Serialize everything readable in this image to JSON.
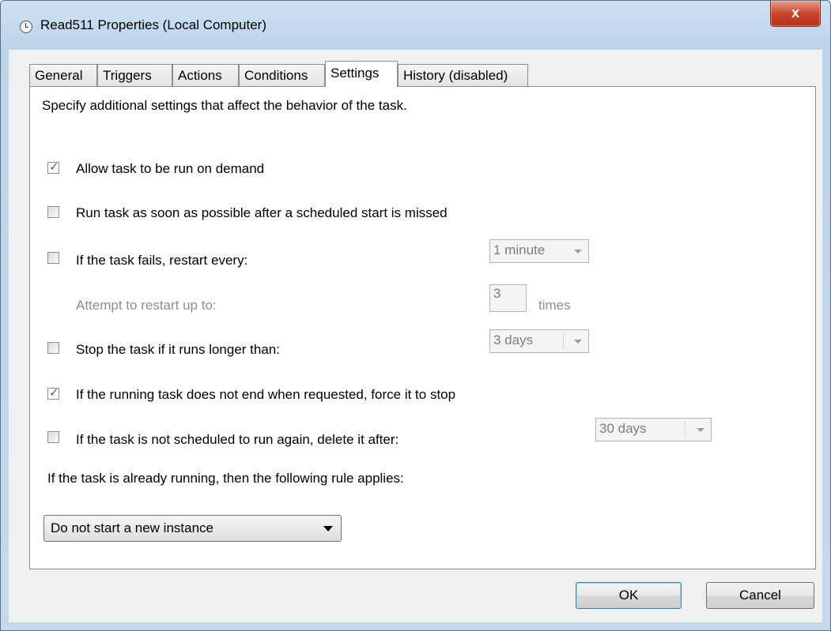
{
  "window": {
    "title": "Read511 Properties (Local Computer)",
    "close_label": "x"
  },
  "tabs": [
    {
      "label": "General",
      "active": false
    },
    {
      "label": "Triggers",
      "active": false
    },
    {
      "label": "Actions",
      "active": false
    },
    {
      "label": "Conditions",
      "active": false
    },
    {
      "label": "Settings",
      "active": true
    },
    {
      "label": "History (disabled)",
      "active": false
    }
  ],
  "settings": {
    "description": "Specify additional settings that affect the behavior of the task.",
    "allow_on_demand": {
      "label": "Allow task to be run on demand",
      "checked": true
    },
    "run_asap": {
      "label": "Run task as soon as possible after a scheduled start is missed",
      "checked": false
    },
    "restart_on_fail": {
      "label": "If the task fails, restart every:",
      "checked": false,
      "value": "1 minute"
    },
    "restart_attempts": {
      "label": "Attempt to restart up to:",
      "value": "3",
      "unit": "times"
    },
    "stop_if_longer": {
      "label": "Stop the task if it runs longer than:",
      "checked": false,
      "value": "3 days"
    },
    "force_stop": {
      "label": "If the running task does not end when requested, force it to stop",
      "checked": true
    },
    "delete_after": {
      "label": "If the task is not scheduled to run again, delete it after:",
      "checked": false,
      "value": "30 days"
    },
    "rule_label": "If the task is already running, then the following rule applies:",
    "rule_value": "Do not start a new instance"
  },
  "buttons": {
    "ok": "OK",
    "cancel": "Cancel"
  }
}
